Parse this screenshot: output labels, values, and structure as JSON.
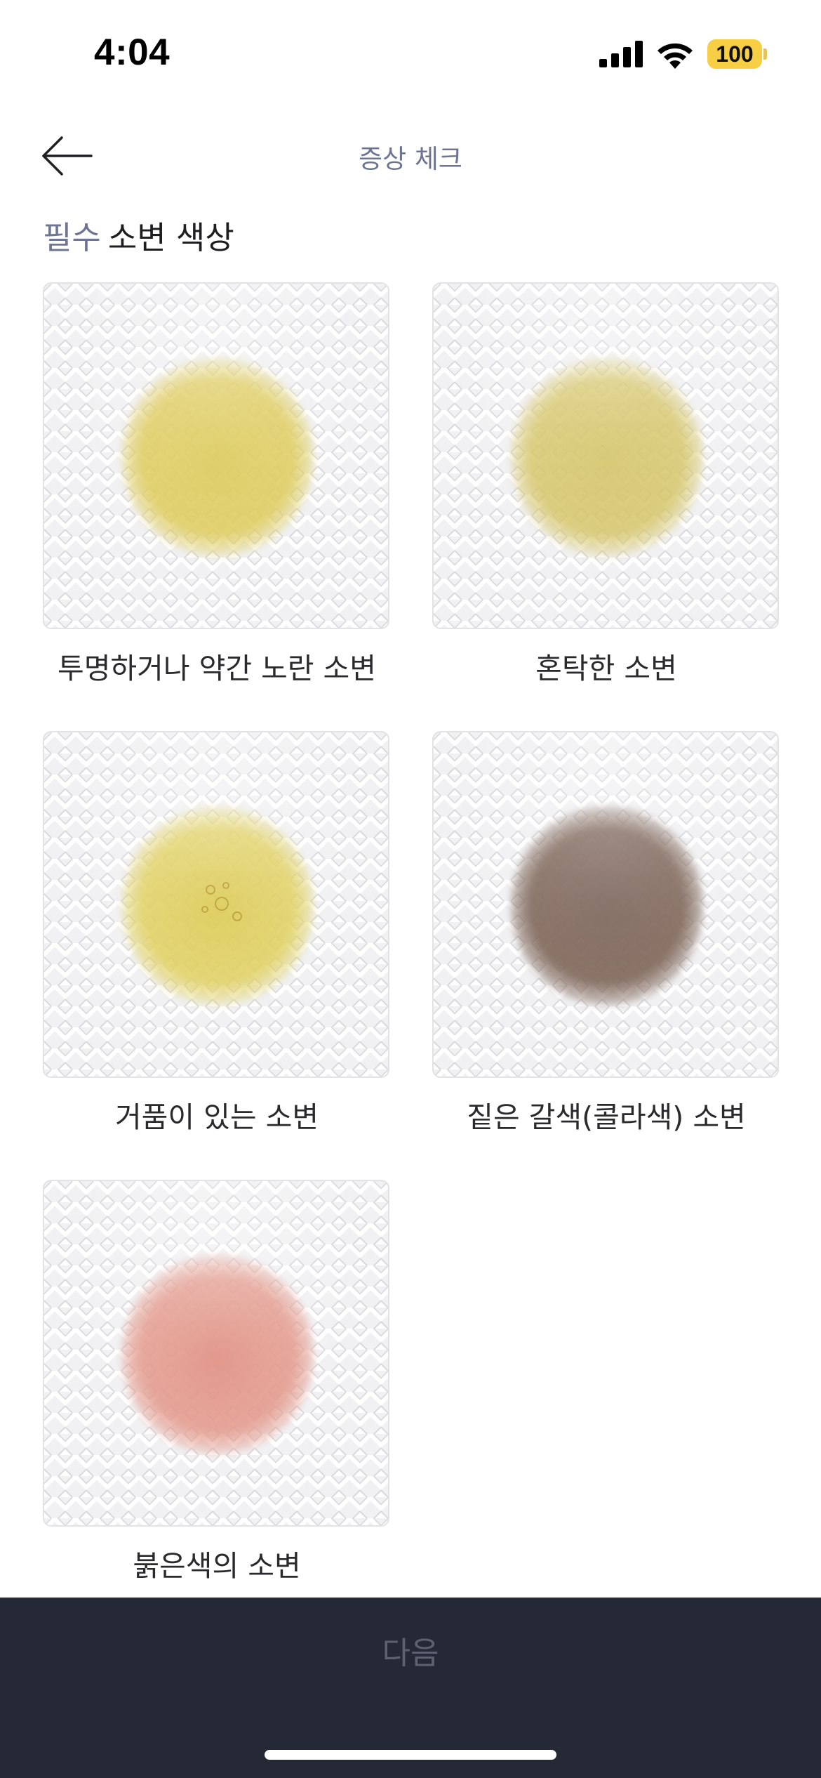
{
  "status_bar": {
    "time": "4:04",
    "battery": "100",
    "signal_icon": "cellular-signal-icon",
    "wifi_icon": "wifi-icon",
    "battery_color": "#f7cf45"
  },
  "header": {
    "back_icon": "arrow-left-icon",
    "title": "증상 체크"
  },
  "section": {
    "required_tag": "필수",
    "title": "소변 색상",
    "required_color": "#6d7593"
  },
  "options": [
    {
      "label": "투명하거나 약간 노란 소변",
      "stain": "pale-yellow"
    },
    {
      "label": "혼탁한 소변",
      "stain": "cloudy-yellow"
    },
    {
      "label": "거품이 있는 소변",
      "stain": "foamy-yellow"
    },
    {
      "label": "짙은 갈색(콜라색) 소변",
      "stain": "dark-brown"
    },
    {
      "label": "붉은색의 소변",
      "stain": "reddish"
    }
  ],
  "footer": {
    "next_label": "다음",
    "background": "#252835",
    "next_color_disabled": "#5d6171"
  }
}
